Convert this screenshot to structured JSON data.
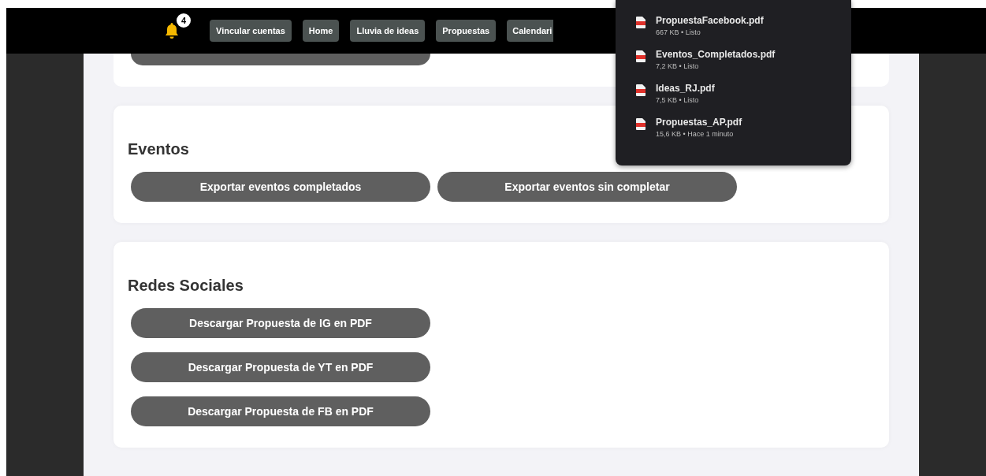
{
  "nav": {
    "notification_count": "4",
    "links": [
      {
        "label": "Vincular cuentas"
      },
      {
        "label": "Home"
      },
      {
        "label": "Lluvia de ideas"
      },
      {
        "label": "Propuestas"
      },
      {
        "label": "Calendari"
      }
    ]
  },
  "downloads": [
    {
      "name": "PropuestaFacebook.pdf",
      "details": "667 KB • Listo"
    },
    {
      "name": "Eventos_Completados.pdf",
      "details": "7,2 KB • Listo"
    },
    {
      "name": "Ideas_RJ.pdf",
      "details": "7,5 KB • Listo"
    },
    {
      "name": "Propuestas_AP.pdf",
      "details": "15,6 KB • Hace 1 minuto"
    }
  ],
  "sections": [
    {
      "title": "Eventos",
      "kind": "row",
      "buttons": [
        "Exportar eventos completados",
        "Exportar eventos sin completar"
      ]
    },
    {
      "title": "Redes Sociales",
      "kind": "column",
      "buttons": [
        "Descargar Propuesta de IG en PDF",
        "Descargar Propuesta de YT en PDF",
        "Descargar Propuesta de FB en PDF"
      ]
    }
  ]
}
